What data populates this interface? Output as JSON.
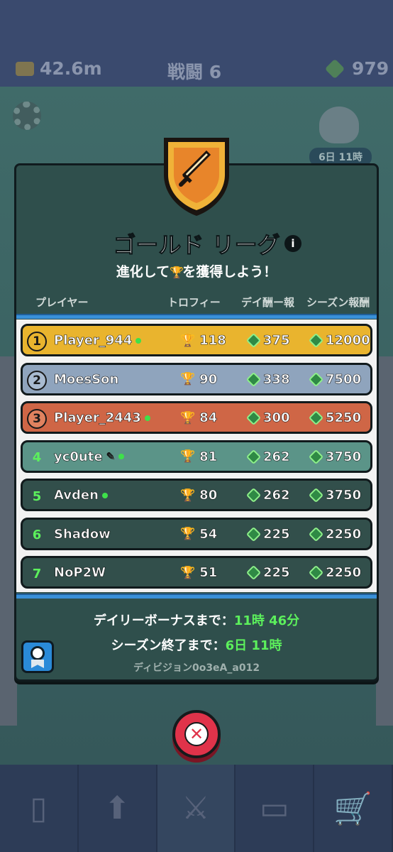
{
  "topbar": {
    "crowns": "42.6m",
    "battle": "戦闘 6",
    "gems": "979"
  },
  "boss_timer": "6日 11時",
  "league": {
    "title": "ゴールド リーグ",
    "info": "i",
    "subtitle_pre": "進化して",
    "subtitle_post": "を獲得しよう！"
  },
  "columns": {
    "player": "プレイヤー",
    "trophy": "トロフィー",
    "daily": "デイ\n酬ー報",
    "daily_text": "デイ酬ー報",
    "season": "シーズン報酬"
  },
  "rows": [
    {
      "rank": "1",
      "name": "Player_944",
      "online": true,
      "edit": false,
      "trophies": "118",
      "daily": "375",
      "season": "12000",
      "color": "#e9b42e",
      "medal": "#e9b42e"
    },
    {
      "rank": "2",
      "name": "MoesSon",
      "online": false,
      "edit": false,
      "trophies": "90",
      "daily": "338",
      "season": "7500",
      "color": "#8fa4bd",
      "medal": "#a9bbd0"
    },
    {
      "rank": "3",
      "name": "Player_2443",
      "online": true,
      "edit": false,
      "trophies": "84",
      "daily": "300",
      "season": "5250",
      "color": "#cf6646",
      "medal": "#e0825f"
    },
    {
      "rank": "4",
      "name": "yc0ute",
      "online": true,
      "edit": true,
      "trophies": "81",
      "daily": "262",
      "season": "3750",
      "color": "#5b9488",
      "medal": ""
    },
    {
      "rank": "5",
      "name": "Avden",
      "online": true,
      "edit": false,
      "trophies": "80",
      "daily": "262",
      "season": "3750",
      "color": "#324f4b",
      "medal": ""
    },
    {
      "rank": "6",
      "name": "Shadow",
      "online": false,
      "edit": false,
      "trophies": "54",
      "daily": "225",
      "season": "2250",
      "color": "#324f4b",
      "medal": ""
    },
    {
      "rank": "7",
      "name": "NoP2W",
      "online": false,
      "edit": false,
      "trophies": "51",
      "daily": "225",
      "season": "2250",
      "color": "#324f4b",
      "medal": ""
    }
  ],
  "footer": {
    "daily_label": "デイリーボーナスまで：",
    "daily_value": "11時 46分",
    "season_label": "シーズン終了まで：",
    "season_value": "6日 11時",
    "division": "ディビジョン0o3eA_a012"
  },
  "icons": {
    "trophy": "🏆",
    "close": "✕"
  },
  "colors": {
    "accent_green": "#5cf05c",
    "blue_line": "#3990d8",
    "close_red": "#e0334a"
  }
}
